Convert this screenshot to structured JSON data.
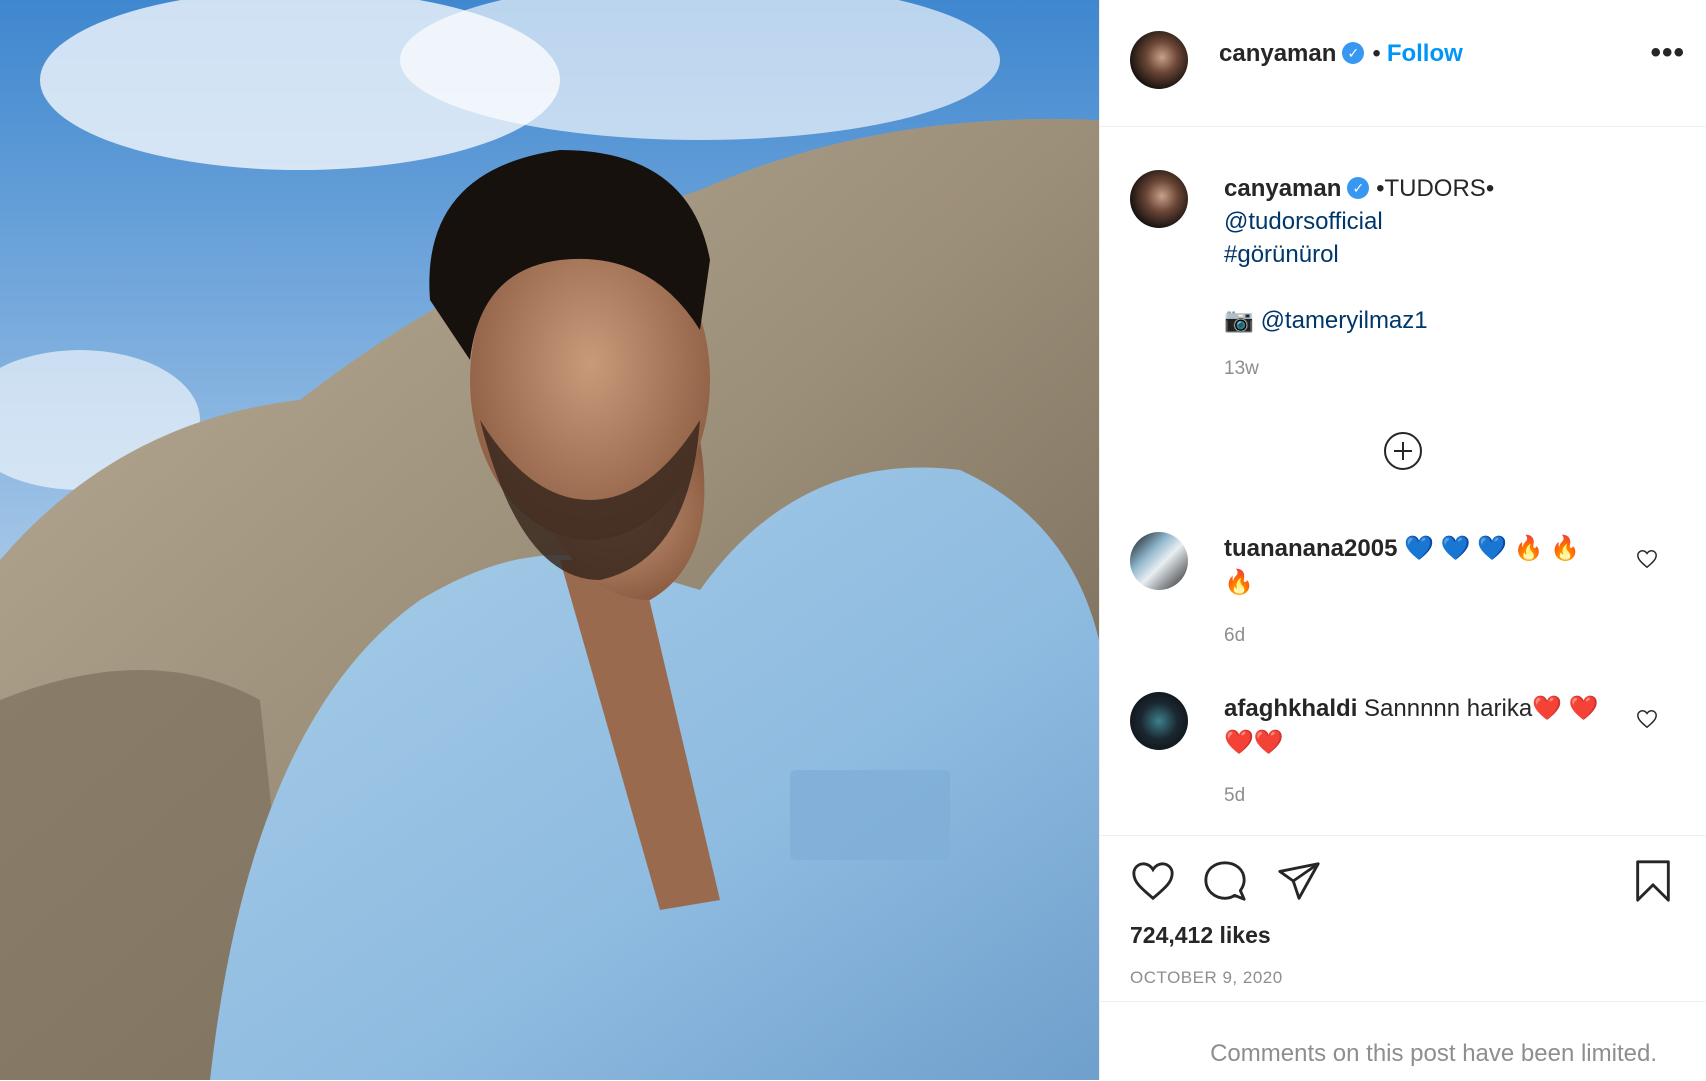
{
  "header": {
    "username": "canyaman",
    "separator": "•",
    "follow_label": "Follow",
    "more_label": "•••"
  },
  "caption": {
    "username": "canyaman",
    "line1": "•TUDORS•",
    "mention1": "@tudorsofficial",
    "hashtag": "#görünürol",
    "camera_emoji": "📷",
    "mention2": "@tameryilmaz1",
    "time": "13w"
  },
  "comments": [
    {
      "username": "tuananana2005",
      "text": "💙 💙 💙 🔥 🔥 🔥",
      "time": "6d"
    },
    {
      "username": "afaghkhaldi",
      "text": "Sannnnn harika❤️ ❤️❤️❤️",
      "time": "5d"
    }
  ],
  "stats": {
    "likes": "724,412 likes",
    "date": "OCTOBER 9, 2020",
    "limited_notice": "Comments on this post have been limited."
  },
  "icons": {
    "like": "heart-icon",
    "comment": "comment-icon",
    "share": "paper-plane-icon",
    "save": "bookmark-icon",
    "load_more": "plus-circle-icon"
  },
  "colors": {
    "link": "#00376b",
    "follow": "#0095f6",
    "verified": "#3897f0",
    "muted": "#8e8e8e"
  }
}
